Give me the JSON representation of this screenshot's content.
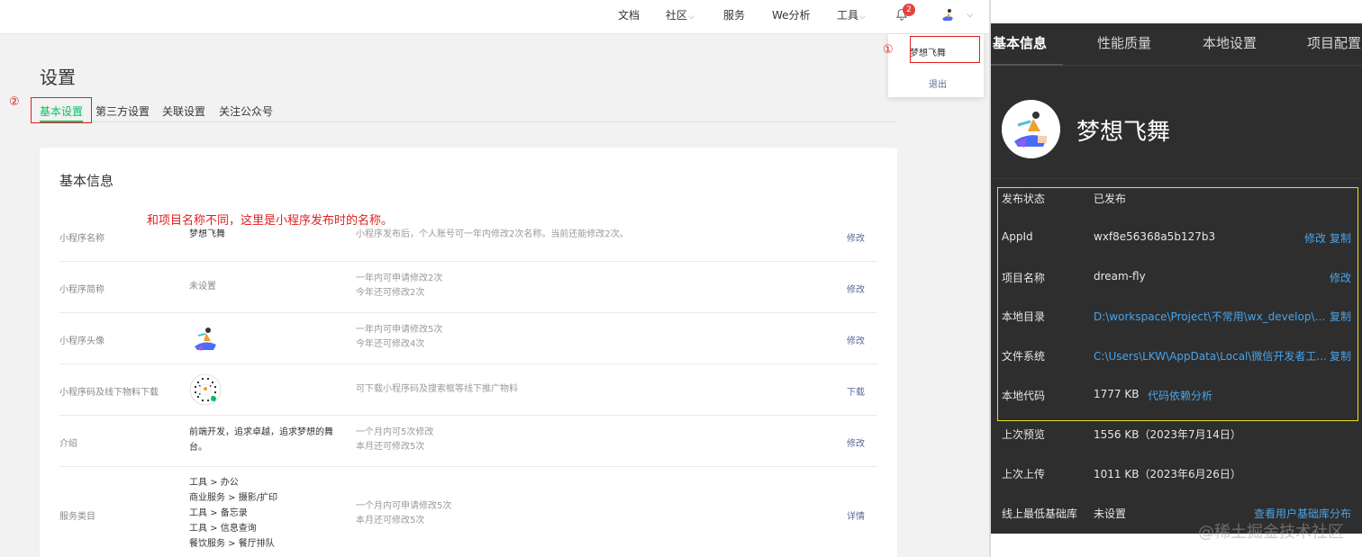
{
  "topnav": {
    "items": [
      "文档",
      "社区",
      "服务",
      "We分析",
      "工具"
    ],
    "notification_count": "2"
  },
  "dropdown": {
    "username": "梦想飞舞",
    "logout": "退出",
    "marker": "①"
  },
  "page": {
    "title": "设置",
    "tabs": [
      "基本设置",
      "第三方设置",
      "关联设置",
      "关注公众号"
    ],
    "tab_marker": "②"
  },
  "card": {
    "title": "基本信息",
    "annotation": "和项目名称不同，这里是小程序发布时的名称。",
    "rows": [
      {
        "label": "小程序名称",
        "value": "梦想飞舞",
        "desc": "小程序发布后，个人账号可一年内修改2次名称。当前还能修改2次。",
        "action": "修改"
      },
      {
        "label": "小程序简称",
        "value": "未设置",
        "desc1": "一年内可申请修改2次",
        "desc2": "今年还可修改2次",
        "action": "修改"
      },
      {
        "label": "小程序头像",
        "desc1": "一年内可申请修改5次",
        "desc2": "今年还可修改4次",
        "action": "修改"
      },
      {
        "label": "小程序码及线下物料下载",
        "desc": "可下载小程序码及搜索框等线下推广物料",
        "action": "下载"
      },
      {
        "label": "介绍",
        "value1": "前端开发，追求卓越，追求梦想的舞",
        "value2": "台。",
        "desc1": "一个月内可5次修改",
        "desc2": "本月还可修改5次",
        "action": "修改"
      },
      {
        "label": "服务类目",
        "lines": [
          "工具 > 办公",
          "商业服务 > 摄影/扩印",
          "工具 > 备忘录",
          "工具 > 信息查询",
          "餐饮服务 > 餐厅排队"
        ],
        "desc1": "一个月内可申请修改5次",
        "desc2": "本月还可修改5次",
        "action": "详情"
      }
    ]
  },
  "panel": {
    "tabs": [
      "基本信息",
      "性能质量",
      "本地设置",
      "项目配置"
    ],
    "name": "梦想飞舞",
    "rows": [
      {
        "label": "发布状态",
        "value": "已发布"
      },
      {
        "label": "AppId",
        "value": "wxf8e56368a5b127b3",
        "action1": "修改",
        "action2": "复制"
      },
      {
        "label": "项目名称",
        "value": "dream-fly",
        "action1": "修改"
      },
      {
        "label": "本地目录",
        "value": "D:\\workspace\\Project\\不常用\\wx_develop\\m...",
        "action2": "复制"
      },
      {
        "label": "文件系统",
        "value": "C:\\Users\\LKW\\AppData\\Local\\微信开发者工...",
        "action2": "复制"
      },
      {
        "label": "本地代码",
        "value": "1777 KB",
        "inline": "代码依赖分析"
      },
      {
        "label": "上次预览",
        "value": "1556 KB（2023年7月14日）"
      },
      {
        "label": "上次上传",
        "value": "1011 KB（2023年6月26日）"
      },
      {
        "label": "线上最低基础库",
        "value": "未设置",
        "action1": "查看用户基础库分布"
      }
    ],
    "watermark": "@稀土掘金技术社区"
  }
}
